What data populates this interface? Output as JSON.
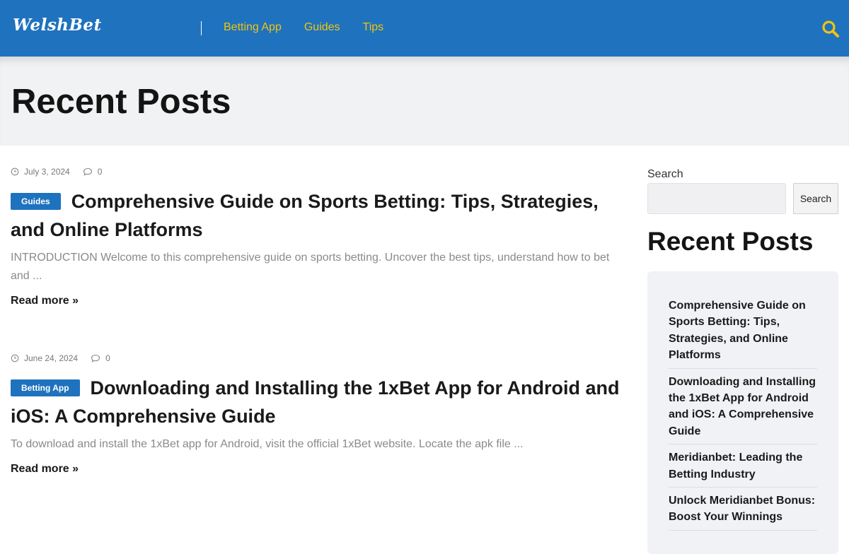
{
  "header": {
    "logo": "WelshBet",
    "nav": [
      "Betting App",
      "Guides",
      "Tips"
    ],
    "accent_color": "#f1c40f",
    "bar_color": "#1f72bd",
    "search_icon": "search-icon"
  },
  "hero": {
    "title": "Recent Posts"
  },
  "posts": [
    {
      "date": "July 3, 2024",
      "comments": "0",
      "category": "Guides",
      "title": "Comprehensive Guide on Sports Betting: Tips, Strategies, and Online Platforms",
      "excerpt": "INTRODUCTION Welcome to this comprehensive guide on sports betting. Uncover the best tips, understand how to bet and ...",
      "read_more": "Read more »"
    },
    {
      "date": "June 24, 2024",
      "comments": "0",
      "category": "Betting App",
      "title": "Downloading and Installing the 1xBet App for Android and iOS: A Comprehensive Guide",
      "excerpt": "To download and install the 1xBet app for Android, visit the official 1xBet website. Locate the apk file ...",
      "read_more": "Read more »"
    }
  ],
  "sidebar": {
    "search_label": "Search",
    "search_button": "Search",
    "recent_title": "Recent Posts",
    "recent_posts": [
      "Comprehensive Guide on Sports Betting: Tips, Strategies, and Online Platforms",
      "Downloading and Installing the 1xBet App for Android and iOS: A Comprehensive Guide",
      "Meridianbet: Leading the Betting Industry",
      "Unlock Meridianbet Bonus: Boost Your Winnings"
    ]
  }
}
